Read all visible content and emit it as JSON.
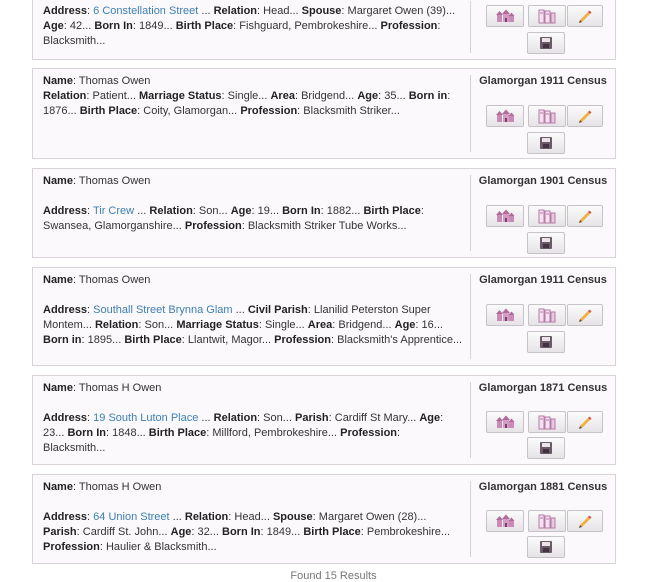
{
  "labels": {
    "name": "Name",
    "address": "Address",
    "relation": "Relation",
    "spouse": "Spouse",
    "age": "Age",
    "born_in": "Born in",
    "born_in_cap": "Born In",
    "birth_place": "Birth Place",
    "profession": "Profession",
    "marriage_status": "Marriage Status",
    "area": "Area",
    "civil_parish": "Civil Parish",
    "parish": "Parish"
  },
  "records": [
    {
      "address": "6 Constellation Street",
      "relation": "Head...",
      "spouse": "Margaret Owen (39)...",
      "age": "42...",
      "born_in": "1849...",
      "birth_place": "Fishguard, Pembrokeshire...",
      "profession": "Blacksmith..."
    },
    {
      "census": "Glamorgan 1911 Census",
      "name": "Thomas Owen",
      "relation": "Patient...",
      "marriage_status": "Single...",
      "area": "Bridgend...",
      "age": "35...",
      "born_in": "1876...",
      "birth_place": "Coity, Glamorgan...",
      "profession": "Blacksmith Striker..."
    },
    {
      "census": "Glamorgan 1901 Census",
      "name": "Thomas Owen",
      "address": "Tir Crew",
      "relation": "Son...",
      "age": "19...",
      "born_in": "1882...",
      "birth_place": "Swansea, Glamorganshire...",
      "profession": "Blacksmith Striker Tube Works..."
    },
    {
      "census": "Glamorgan 1911 Census",
      "name": "Thomas Owen",
      "address": "Southall Street Brynna Glam",
      "civil_parish": "Llanilid Peterston Super Montem...",
      "relation": "Son...",
      "marriage_status": "Single...",
      "area": "Bridgend...",
      "age": "16...",
      "born_in": "1895...",
      "birth_place": "Llantwit, Magor...",
      "profession": "Blacksmith's Apprentice..."
    },
    {
      "census": "Glamorgan 1871 Census",
      "name": "Thomas H Owen",
      "address": "19 South Luton Place",
      "relation": "Son...",
      "parish": "Cardiff St Mary...",
      "age": "23...",
      "born_in": "1848...",
      "birth_place": "Millford, Pembrokeshire...",
      "profession": "Blacksmith..."
    },
    {
      "census": "Glamorgan 1881 Census",
      "name": "Thomas H Owen",
      "address": "64 Union Street",
      "relation": "Head...",
      "spouse": "Margaret Owen (28)...",
      "parish": "Cardiff St. John...",
      "age": "32...",
      "born_in": "1849...",
      "birth_place": "Pembrokeshire...",
      "profession": "Haulier & Blacksmith..."
    }
  ],
  "icons": {
    "household": "household-icon",
    "records": "records-icon",
    "edit": "pencil-icon",
    "save": "save-icon"
  },
  "colors": {
    "link": "#3b7fb5",
    "card_bg": "#fcf9fc",
    "icon_pink": "#c98ab8"
  },
  "footer_text": "Found 15 Results"
}
